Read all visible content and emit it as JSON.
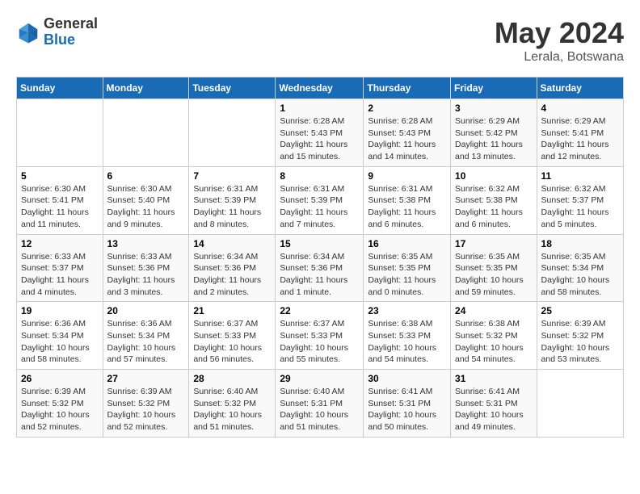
{
  "header": {
    "logo_general": "General",
    "logo_blue": "Blue",
    "title": "May 2024",
    "location": "Lerala, Botswana"
  },
  "weekdays": [
    "Sunday",
    "Monday",
    "Tuesday",
    "Wednesday",
    "Thursday",
    "Friday",
    "Saturday"
  ],
  "weeks": [
    [
      {
        "day": "",
        "info": ""
      },
      {
        "day": "",
        "info": ""
      },
      {
        "day": "",
        "info": ""
      },
      {
        "day": "1",
        "info": "Sunrise: 6:28 AM\nSunset: 5:43 PM\nDaylight: 11 hours\nand 15 minutes."
      },
      {
        "day": "2",
        "info": "Sunrise: 6:28 AM\nSunset: 5:43 PM\nDaylight: 11 hours\nand 14 minutes."
      },
      {
        "day": "3",
        "info": "Sunrise: 6:29 AM\nSunset: 5:42 PM\nDaylight: 11 hours\nand 13 minutes."
      },
      {
        "day": "4",
        "info": "Sunrise: 6:29 AM\nSunset: 5:41 PM\nDaylight: 11 hours\nand 12 minutes."
      }
    ],
    [
      {
        "day": "5",
        "info": "Sunrise: 6:30 AM\nSunset: 5:41 PM\nDaylight: 11 hours\nand 11 minutes."
      },
      {
        "day": "6",
        "info": "Sunrise: 6:30 AM\nSunset: 5:40 PM\nDaylight: 11 hours\nand 9 minutes."
      },
      {
        "day": "7",
        "info": "Sunrise: 6:31 AM\nSunset: 5:39 PM\nDaylight: 11 hours\nand 8 minutes."
      },
      {
        "day": "8",
        "info": "Sunrise: 6:31 AM\nSunset: 5:39 PM\nDaylight: 11 hours\nand 7 minutes."
      },
      {
        "day": "9",
        "info": "Sunrise: 6:31 AM\nSunset: 5:38 PM\nDaylight: 11 hours\nand 6 minutes."
      },
      {
        "day": "10",
        "info": "Sunrise: 6:32 AM\nSunset: 5:38 PM\nDaylight: 11 hours\nand 6 minutes."
      },
      {
        "day": "11",
        "info": "Sunrise: 6:32 AM\nSunset: 5:37 PM\nDaylight: 11 hours\nand 5 minutes."
      }
    ],
    [
      {
        "day": "12",
        "info": "Sunrise: 6:33 AM\nSunset: 5:37 PM\nDaylight: 11 hours\nand 4 minutes."
      },
      {
        "day": "13",
        "info": "Sunrise: 6:33 AM\nSunset: 5:36 PM\nDaylight: 11 hours\nand 3 minutes."
      },
      {
        "day": "14",
        "info": "Sunrise: 6:34 AM\nSunset: 5:36 PM\nDaylight: 11 hours\nand 2 minutes."
      },
      {
        "day": "15",
        "info": "Sunrise: 6:34 AM\nSunset: 5:36 PM\nDaylight: 11 hours\nand 1 minute."
      },
      {
        "day": "16",
        "info": "Sunrise: 6:35 AM\nSunset: 5:35 PM\nDaylight: 11 hours\nand 0 minutes."
      },
      {
        "day": "17",
        "info": "Sunrise: 6:35 AM\nSunset: 5:35 PM\nDaylight: 10 hours\nand 59 minutes."
      },
      {
        "day": "18",
        "info": "Sunrise: 6:35 AM\nSunset: 5:34 PM\nDaylight: 10 hours\nand 58 minutes."
      }
    ],
    [
      {
        "day": "19",
        "info": "Sunrise: 6:36 AM\nSunset: 5:34 PM\nDaylight: 10 hours\nand 58 minutes."
      },
      {
        "day": "20",
        "info": "Sunrise: 6:36 AM\nSunset: 5:34 PM\nDaylight: 10 hours\nand 57 minutes."
      },
      {
        "day": "21",
        "info": "Sunrise: 6:37 AM\nSunset: 5:33 PM\nDaylight: 10 hours\nand 56 minutes."
      },
      {
        "day": "22",
        "info": "Sunrise: 6:37 AM\nSunset: 5:33 PM\nDaylight: 10 hours\nand 55 minutes."
      },
      {
        "day": "23",
        "info": "Sunrise: 6:38 AM\nSunset: 5:33 PM\nDaylight: 10 hours\nand 54 minutes."
      },
      {
        "day": "24",
        "info": "Sunrise: 6:38 AM\nSunset: 5:32 PM\nDaylight: 10 hours\nand 54 minutes."
      },
      {
        "day": "25",
        "info": "Sunrise: 6:39 AM\nSunset: 5:32 PM\nDaylight: 10 hours\nand 53 minutes."
      }
    ],
    [
      {
        "day": "26",
        "info": "Sunrise: 6:39 AM\nSunset: 5:32 PM\nDaylight: 10 hours\nand 52 minutes."
      },
      {
        "day": "27",
        "info": "Sunrise: 6:39 AM\nSunset: 5:32 PM\nDaylight: 10 hours\nand 52 minutes."
      },
      {
        "day": "28",
        "info": "Sunrise: 6:40 AM\nSunset: 5:32 PM\nDaylight: 10 hours\nand 51 minutes."
      },
      {
        "day": "29",
        "info": "Sunrise: 6:40 AM\nSunset: 5:31 PM\nDaylight: 10 hours\nand 51 minutes."
      },
      {
        "day": "30",
        "info": "Sunrise: 6:41 AM\nSunset: 5:31 PM\nDaylight: 10 hours\nand 50 minutes."
      },
      {
        "day": "31",
        "info": "Sunrise: 6:41 AM\nSunset: 5:31 PM\nDaylight: 10 hours\nand 49 minutes."
      },
      {
        "day": "",
        "info": ""
      }
    ]
  ]
}
